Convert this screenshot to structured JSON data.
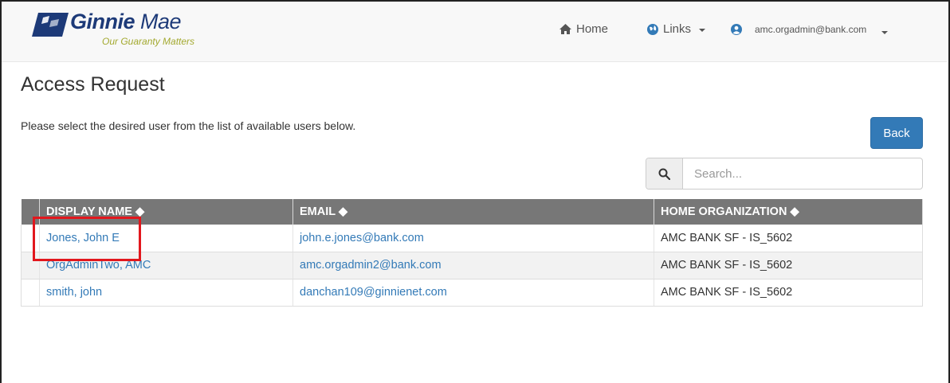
{
  "brand": {
    "name_bold": "Ginnie",
    "name_light": "Mae",
    "tagline": "Our Guaranty Matters",
    "accent_blue": "#1d3a78",
    "accent_olive": "#a3a92f"
  },
  "nav": {
    "home_label": "Home",
    "home_icon": "home-icon",
    "links_label": "Links",
    "links_icon": "globe-icon",
    "user_email": "amc.orgadmin@bank.com",
    "user_icon": "user-circle-icon"
  },
  "page": {
    "title": "Access Request",
    "intro": "Please select the desired user from the list of available users below.",
    "back_label": "Back"
  },
  "search": {
    "placeholder": "Search...",
    "value": ""
  },
  "table": {
    "headers": {
      "name": "DISPLAY NAME ◆",
      "email": "EMAIL ◆",
      "org": "HOME ORGANIZATION ◆"
    },
    "rows": [
      {
        "name": "Jones, John E",
        "email": "john.e.jones@bank.com",
        "org": "AMC BANK SF - IS_5602"
      },
      {
        "name": "OrgAdminTwo, AMC",
        "email": "amc.orgadmin2@bank.com",
        "org": "AMC BANK SF - IS_5602"
      },
      {
        "name": "smith, john",
        "email": "danchan109@ginnienet.com",
        "org": "AMC BANK SF - IS_5602"
      }
    ]
  },
  "colors": {
    "primary": "#337ab7",
    "table_header": "#777777",
    "highlight": "#e2171d"
  }
}
